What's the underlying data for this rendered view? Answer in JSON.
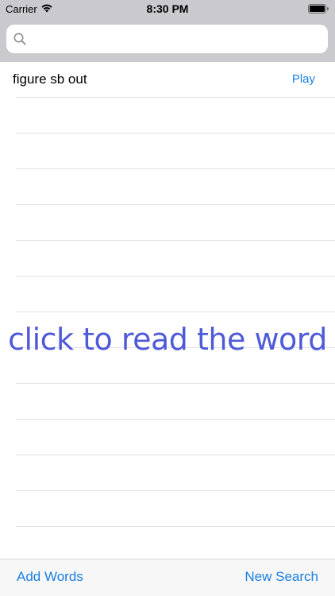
{
  "status_bar": {
    "carrier": "Carrier",
    "time": "8:30 PM",
    "icons": [
      "wifi-icon",
      "battery-icon"
    ]
  },
  "search": {
    "value": "",
    "placeholder": ""
  },
  "list": {
    "rows": [
      {
        "word": "figure sb out",
        "action": "Play"
      }
    ]
  },
  "caption": "click to read the word",
  "toolbar": {
    "add_words_label": "Add Words",
    "new_search_label": "New Search"
  },
  "colors": {
    "accent": "#1a7fe0",
    "caption": "#4f5ad9",
    "bar_gray": "#c9c9ce"
  }
}
